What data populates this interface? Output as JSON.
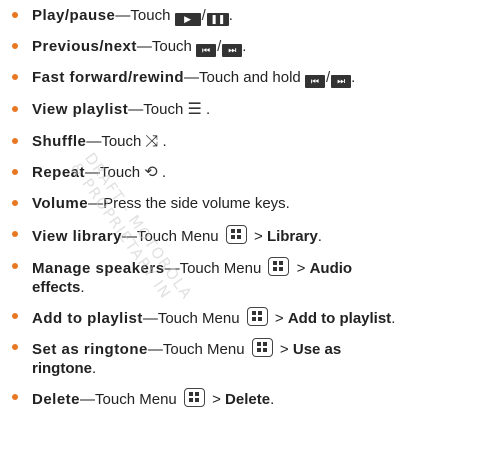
{
  "items": [
    {
      "term": "Play/pause",
      "dash": "—",
      "desc": "Touch"
    },
    {
      "term": "Previous/next",
      "dash": "—",
      "desc": "Touch"
    },
    {
      "term": "Fast forward/rewind",
      "dash": "—",
      "desc": "Touch and hold"
    },
    {
      "term": "View playlist",
      "dash": "—",
      "desc": "Touch"
    },
    {
      "term": "Shuffle",
      "dash": "—",
      "desc": "Touch"
    },
    {
      "term": "Repeat",
      "dash": "—",
      "desc": "Touch"
    },
    {
      "term": "Volume",
      "dash": "—",
      "desc": "Press the side volume keys."
    },
    {
      "term": "View library",
      "dash": "—",
      "desc": "Touch Menu",
      "gt": ">",
      "target": "Library",
      "end": "."
    },
    {
      "term": "Manage speakers",
      "dash": "—",
      "desc": "Touch Menu",
      "gt": ">",
      "target1": "Audio",
      "target2": "effects",
      "end": "."
    },
    {
      "term": "Add to playlist",
      "dash": "—",
      "desc": "Touch Menu",
      "gt": ">",
      "target": "Add to playlist",
      "end": "."
    },
    {
      "term": "Set as ringtone",
      "dash": "—",
      "desc": "Touch Menu",
      "gt": ">",
      "target1": "Use as",
      "target2": "ringtone",
      "end": "."
    },
    {
      "term": "Delete",
      "dash": "—",
      "desc": "Touch Menu",
      "gt": ">",
      "target": "Delete",
      "end": "."
    }
  ],
  "icons": {
    "play": "play-icon",
    "pause": "pause-icon",
    "previous": "previous-track-icon",
    "next": "next-track-icon",
    "playlist": "playlist-icon",
    "shuffle": "shuffle-icon",
    "repeat": "repeat-icon",
    "menu": "menu-key-icon"
  },
  "punct": {
    "slash": "/",
    "period": "."
  },
  "watermark": {
    "line1": "DRAFT - MOTOROLA",
    "line2": "& PROPRIETARY IN"
  },
  "colors": {
    "bullet": "#e87722",
    "text": "#222222",
    "watermark": "#c9c9c9"
  }
}
